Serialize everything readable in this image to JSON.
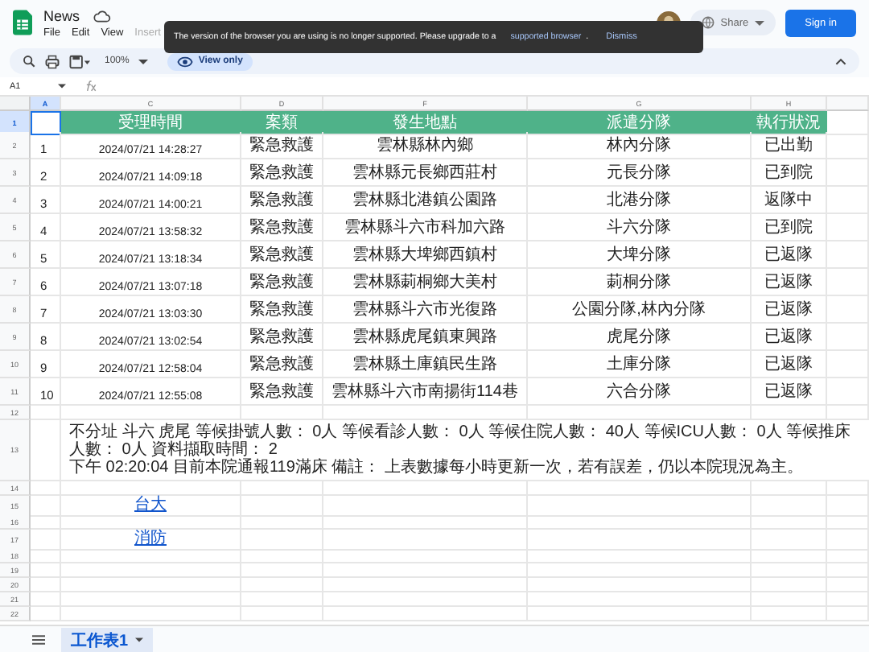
{
  "app": {
    "title": "News",
    "menu": [
      {
        "label": "File",
        "disabled": false
      },
      {
        "label": "Edit",
        "disabled": false
      },
      {
        "label": "View",
        "disabled": false
      },
      {
        "label": "Insert",
        "disabled": true
      }
    ],
    "share": "Share",
    "sign_in": "Sign in"
  },
  "toolbar": {
    "zoom": "100%",
    "mode": "View only"
  },
  "toast": {
    "message": "The version of the browser you are using is no longer supported. Please upgrade to a",
    "link": "supported browser",
    "period": ".",
    "dismiss": "Dismiss"
  },
  "formula_bar": {
    "cell": "A1"
  },
  "columns": [
    "A",
    "C",
    "D",
    "F",
    "G",
    "H"
  ],
  "header": [
    "受理時間",
    "案類",
    "發生地點",
    "派遣分隊",
    "執行狀況"
  ],
  "rows": [
    {
      "no": "1",
      "time": "2024/07/21 14:28:27",
      "type": "緊急救護",
      "place": "雲林縣林內鄉",
      "unit": "林內分隊",
      "status": "已出勤"
    },
    {
      "no": "2",
      "time": "2024/07/21 14:09:18",
      "type": "緊急救護",
      "place": "雲林縣元長鄉西莊村",
      "unit": "元長分隊",
      "status": "已到院"
    },
    {
      "no": "3",
      "time": "2024/07/21 14:00:21",
      "type": "緊急救護",
      "place": "雲林縣北港鎮公園路",
      "unit": "北港分隊",
      "status": "返隊中"
    },
    {
      "no": "4",
      "time": "2024/07/21 13:58:32",
      "type": "緊急救護",
      "place": "雲林縣斗六市科加六路",
      "unit": "斗六分隊",
      "status": "已到院"
    },
    {
      "no": "5",
      "time": "2024/07/21 13:18:34",
      "type": "緊急救護",
      "place": "雲林縣大埤鄉西鎮村",
      "unit": "大埤分隊",
      "status": "已返隊"
    },
    {
      "no": "6",
      "time": "2024/07/21 13:07:18",
      "type": "緊急救護",
      "place": "雲林縣莿桐鄉大美村",
      "unit": "莿桐分隊",
      "status": "已返隊"
    },
    {
      "no": "7",
      "time": "2024/07/21 13:03:30",
      "type": "緊急救護",
      "place": "雲林縣斗六市光復路",
      "unit": "公園分隊,林內分隊",
      "status": "已返隊"
    },
    {
      "no": "8",
      "time": "2024/07/21 13:02:54",
      "type": "緊急救護",
      "place": "雲林縣虎尾鎮東興路",
      "unit": "虎尾分隊",
      "status": "已返隊"
    },
    {
      "no": "9",
      "time": "2024/07/21 12:58:04",
      "type": "緊急救護",
      "place": "雲林縣土庫鎮民生路",
      "unit": "土庫分隊",
      "status": "已返隊"
    },
    {
      "no": "10",
      "time": "2024/07/21 12:55:08",
      "type": "緊急救護",
      "place": "雲林縣斗六市南揚街114巷",
      "unit": "六合分隊",
      "status": "已返隊"
    }
  ],
  "note": [
    "不分址 斗六 虎尾  等候掛號人數： 0人 等候看診人數： 0人 等候住院人數： 40人 等候ICU人數： 0人 等候推床人數： 0人 資料擷取時間： 2",
    "下午 02:20:04  目前本院通報119滿床 備註： 上表數據每小時更新一次，若有誤差，仍以本院現況為主。"
  ],
  "links": [
    "台大",
    "消防"
  ],
  "row_numbers": [
    "1",
    "2",
    "3",
    "4",
    "5",
    "6",
    "7",
    "8",
    "9",
    "10",
    "11",
    "12",
    "13",
    "14",
    "15",
    "16",
    "17",
    "18",
    "19",
    "20",
    "21",
    "22"
  ],
  "sheet_tabs": [
    {
      "label": "工作表1",
      "selected": true
    }
  ]
}
